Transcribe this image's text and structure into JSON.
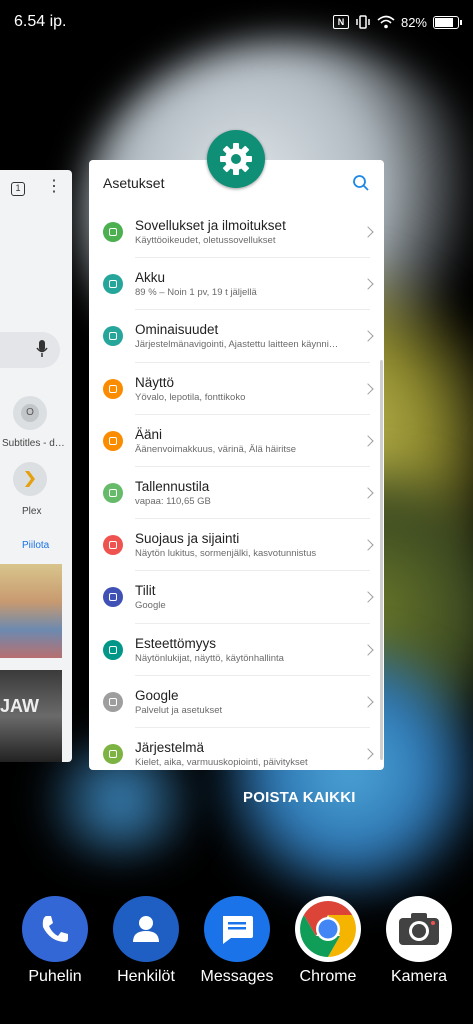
{
  "status_bar": {
    "time": "6.54 ip.",
    "battery": "82%",
    "battery_level": 0.82
  },
  "recents": {
    "previous_card": {
      "tab_count": "1",
      "suggestion_icon_letter": "O",
      "suggestion_subtitles": "Subtitles - d…",
      "suggestion_plex": "Plex",
      "hide_link": "Piilota",
      "photo_text": "JAW"
    },
    "settings_card": {
      "title": "Asetukset",
      "items": [
        {
          "label": "Sovellukset ja ilmoitukset",
          "sub": "Käyttöoikeudet, oletussovellukset",
          "color": "#4caf50",
          "icon": "apps-grid-icon"
        },
        {
          "label": "Akku",
          "sub": "89 % – Noin 1 pv, 19 t jäljellä",
          "color": "#26a69a",
          "icon": "battery-icon"
        },
        {
          "label": "Ominaisuudet",
          "sub": "Järjestelmänavigointi, Ajastettu laitteen käynni…",
          "color": "#26a69a",
          "icon": "gesture-hand-icon"
        },
        {
          "label": "Näyttö",
          "sub": "Yövalo, lepotila, fonttikoko",
          "color": "#fb8c00",
          "icon": "brightness-icon"
        },
        {
          "label": "Ääni",
          "sub": "Äänenvoimakkuus, värinä, Älä häiritse",
          "color": "#fb8c00",
          "icon": "volume-icon"
        },
        {
          "label": "Tallennustila",
          "sub": "vapaa: 110,65 GB",
          "color": "#66bb6a",
          "icon": "storage-icon"
        },
        {
          "label": "Suojaus ja sijainti",
          "sub": "Näytön lukitus, sormenjälki, kasvotunnistus",
          "color": "#ef5350",
          "icon": "lock-icon"
        },
        {
          "label": "Tilit",
          "sub": "Google",
          "color": "#3f51b5",
          "icon": "account-icon"
        },
        {
          "label": "Esteettömyys",
          "sub": "Näytönlukijat, näyttö, käytönhallinta",
          "color": "#009688",
          "icon": "accessibility-icon"
        },
        {
          "label": "Google",
          "sub": "Palvelut ja asetukset",
          "color": "#9e9e9e",
          "icon": "google-icon"
        },
        {
          "label": "Järjestelmä",
          "sub": "Kielet, aika, varmuuskopiointi, päivitykset",
          "color": "#7cb342",
          "icon": "info-icon"
        }
      ]
    },
    "clear_all": "POISTA KAIKKI"
  },
  "dock": [
    {
      "label": "Puhelin",
      "color": "#3367d6",
      "icon": "phone-icon"
    },
    {
      "label": "Henkilöt",
      "color": "#1f5fc4",
      "icon": "contacts-icon"
    },
    {
      "label": "Messages",
      "color": "#1a73e8",
      "icon": "messages-icon"
    },
    {
      "label": "Chrome",
      "color": "#ffffff",
      "icon": "chrome-icon"
    },
    {
      "label": "Kamera",
      "color": "#ffffff",
      "icon": "camera-icon"
    }
  ]
}
